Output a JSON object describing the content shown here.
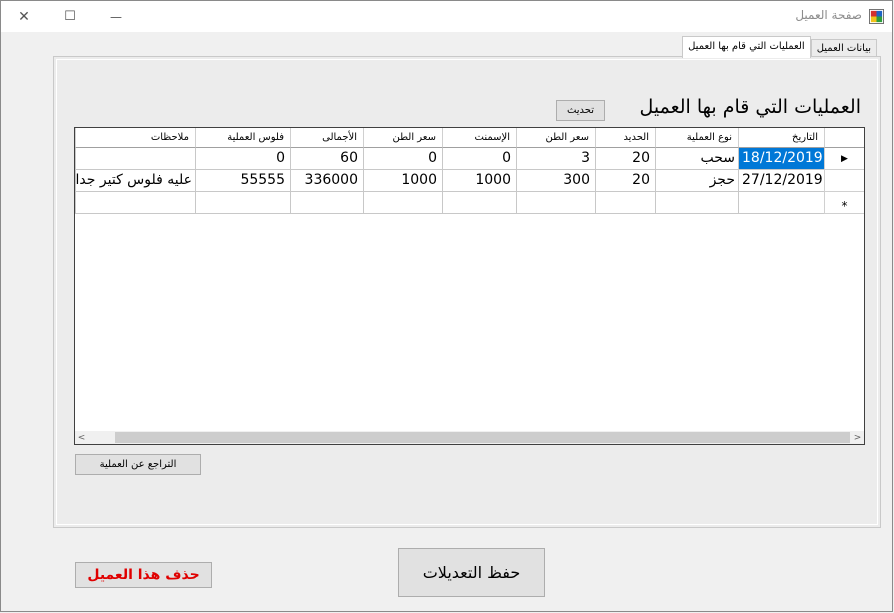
{
  "window": {
    "title": "صفحة العميل",
    "controls": {
      "minimize": "—",
      "maximize": "☐",
      "close": "✕"
    }
  },
  "tabs": [
    {
      "label": "بيانات العميل",
      "active": false
    },
    {
      "label": "العمليات التي قام بها العميل",
      "active": true
    }
  ],
  "main": {
    "heading": "العمليات التي قام بها العميل",
    "refresh_label": "تحديث"
  },
  "grid": {
    "columns": [
      "التاريخ",
      "نوع العملية",
      "الحديد",
      "سعر الطن",
      "الإسمنت",
      "سعر الطن",
      "الأجمالى",
      "فلوس العملية",
      "ملاحظات"
    ],
    "rows": [
      {
        "indicator": "▶",
        "cells": [
          "18/12/2019",
          "سحب",
          "20",
          "3",
          "0",
          "0",
          "60",
          "0",
          ""
        ]
      },
      {
        "indicator": "",
        "cells": [
          "27/12/2019",
          "حجز",
          "20",
          "300",
          "1000",
          "1000",
          "336000",
          "55555",
          "عليه فلوس كتير جدا"
        ]
      }
    ],
    "new_row_indicator": "*",
    "scroll_left": "<",
    "scroll_right": ">"
  },
  "actions": {
    "undo_label": "التراجع عن العملية",
    "save_label": "حفظ التعديلات",
    "delete_label": "حذف هذا العميل"
  },
  "colors": {
    "selection": "#0078d7",
    "delete_text": "#e00000",
    "window_bg": "#f0f0f0"
  }
}
